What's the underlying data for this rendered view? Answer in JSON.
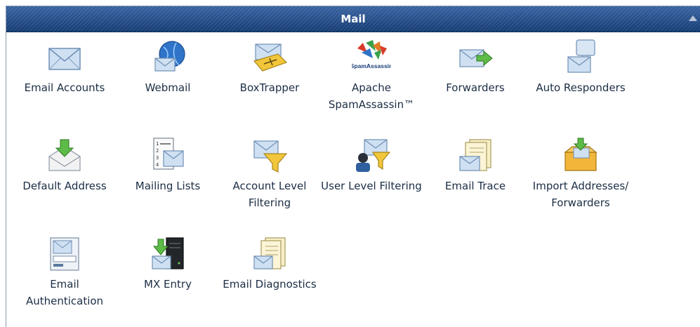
{
  "panel": {
    "title": "Mail"
  },
  "items": [
    {
      "name": "email-accounts",
      "label": "Email Accounts",
      "icon": "envelope-icon"
    },
    {
      "name": "webmail",
      "label": "Webmail",
      "icon": "webmail-globe-icon"
    },
    {
      "name": "boxtrapper",
      "label": "BoxTrapper",
      "icon": "boxtrapper-icon"
    },
    {
      "name": "apache-spamassassin",
      "label": "Apache SpamAssassin™",
      "icon": "spamassassin-icon",
      "logo_text": "SpamAssassin"
    },
    {
      "name": "forwarders",
      "label": "Forwarders",
      "icon": "forwarders-icon"
    },
    {
      "name": "auto-responders",
      "label": "Auto Responders",
      "icon": "auto-responders-icon"
    },
    {
      "name": "default-address",
      "label": "Default Address",
      "icon": "default-address-icon"
    },
    {
      "name": "mailing-lists",
      "label": "Mailing Lists",
      "icon": "mailing-lists-icon"
    },
    {
      "name": "account-level-filtering",
      "label": "Account Level Filtering",
      "icon": "account-filter-icon"
    },
    {
      "name": "user-level-filtering",
      "label": "User Level Filtering",
      "icon": "user-filter-icon"
    },
    {
      "name": "email-trace",
      "label": "Email Trace",
      "icon": "email-trace-icon"
    },
    {
      "name": "import-addresses-forwarders",
      "label": "Import Addresses/ Forwarders",
      "icon": "import-box-icon"
    },
    {
      "name": "email-authentication",
      "label": "Email Authentication",
      "icon": "email-authentication-icon"
    },
    {
      "name": "mx-entry",
      "label": "MX Entry",
      "icon": "mx-server-icon"
    },
    {
      "name": "email-diagnostics",
      "label": "Email Diagnostics",
      "icon": "email-diagnostics-icon"
    }
  ]
}
